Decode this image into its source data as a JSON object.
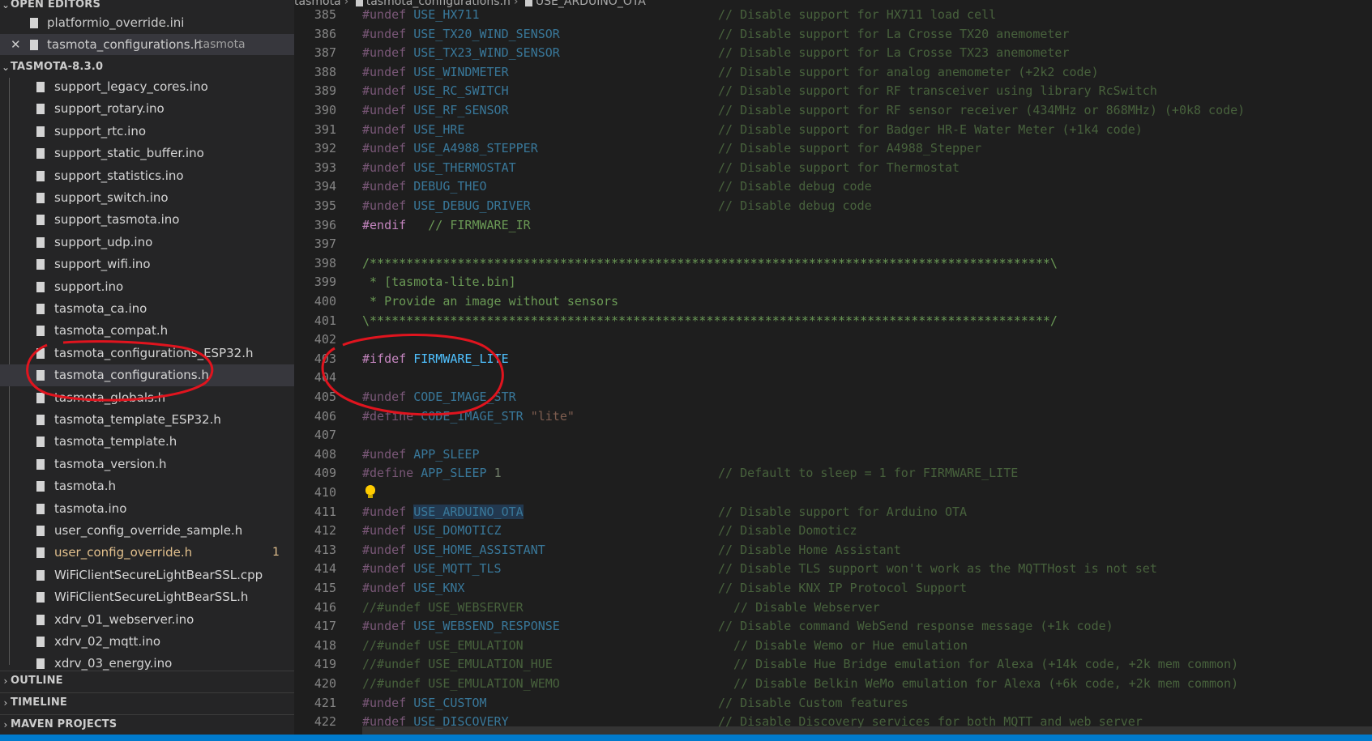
{
  "sidebar": {
    "open_editors_header": "OPEN EDITORS",
    "open_editors": [
      {
        "name": "platformio_override.ini",
        "desc": "",
        "active": false
      },
      {
        "name": "tasmota_configurations.h",
        "desc": "tasmota",
        "active": true
      }
    ],
    "project_header": "TASMOTA-8.3.0",
    "files": [
      {
        "name": "support_legacy_cores.ino"
      },
      {
        "name": "support_rotary.ino"
      },
      {
        "name": "support_rtc.ino"
      },
      {
        "name": "support_static_buffer.ino"
      },
      {
        "name": "support_statistics.ino"
      },
      {
        "name": "support_switch.ino"
      },
      {
        "name": "support_tasmota.ino"
      },
      {
        "name": "support_udp.ino"
      },
      {
        "name": "support_wifi.ino"
      },
      {
        "name": "support.ino"
      },
      {
        "name": "tasmota_ca.ino"
      },
      {
        "name": "tasmota_compat.h"
      },
      {
        "name": "tasmota_configurations_ESP32.h"
      },
      {
        "name": "tasmota_configurations.h",
        "active": true
      },
      {
        "name": "tasmota_globals.h"
      },
      {
        "name": "tasmota_template_ESP32.h"
      },
      {
        "name": "tasmota_template.h"
      },
      {
        "name": "tasmota_version.h"
      },
      {
        "name": "tasmota.h"
      },
      {
        "name": "tasmota.ino"
      },
      {
        "name": "user_config_override_sample.h"
      },
      {
        "name": "user_config_override.h",
        "modified": true,
        "badge": "1"
      },
      {
        "name": "WiFiClientSecureLightBearSSL.cpp"
      },
      {
        "name": "WiFiClientSecureLightBearSSL.h"
      },
      {
        "name": "xdrv_01_webserver.ino"
      },
      {
        "name": "xdrv_02_mqtt.ino"
      },
      {
        "name": "xdrv_03_energy.ino"
      }
    ],
    "outline_header": "OUTLINE",
    "timeline_header": "TIMELINE",
    "maven_header": "MAVEN PROJECTS"
  },
  "breadcrumb": [
    "tasmota",
    "tasmota_configurations.h",
    "USE_ARDUINO_OTA"
  ],
  "colors": {
    "directive": "#c586c0",
    "macro": "#4fc1ff",
    "comment": "#6a9955",
    "string": "#ce9178",
    "number": "#b5cea8",
    "annotation": "#e0141e"
  },
  "code_lines": [
    {
      "n": "385",
      "d": "#undef",
      "m": "USE_HX711",
      "c": "// Disable support for HX711 load cell",
      "inactive": true
    },
    {
      "n": "386",
      "d": "#undef",
      "m": "USE_TX20_WIND_SENSOR",
      "c": "// Disable support for La Crosse TX20 anemometer",
      "inactive": true
    },
    {
      "n": "387",
      "d": "#undef",
      "m": "USE_TX23_WIND_SENSOR",
      "c": "// Disable support for La Crosse TX23 anemometer",
      "inactive": true
    },
    {
      "n": "388",
      "d": "#undef",
      "m": "USE_WINDMETER",
      "c": "// Disable support for analog anemometer (+2k2 code)",
      "inactive": true
    },
    {
      "n": "389",
      "d": "#undef",
      "m": "USE_RC_SWITCH",
      "c": "// Disable support for RF transceiver using library RcSwitch",
      "inactive": true
    },
    {
      "n": "390",
      "d": "#undef",
      "m": "USE_RF_SENSOR",
      "c": "// Disable support for RF sensor receiver (434MHz or 868MHz) (+0k8 code)",
      "inactive": true
    },
    {
      "n": "391",
      "d": "#undef",
      "m": "USE_HRE",
      "c": "// Disable support for Badger HR-E Water Meter (+1k4 code)",
      "inactive": true
    },
    {
      "n": "392",
      "d": "#undef",
      "m": "USE_A4988_STEPPER",
      "c": "// Disable support for A4988_Stepper",
      "inactive": true
    },
    {
      "n": "393",
      "d": "#undef",
      "m": "USE_THERMOSTAT",
      "c": "// Disable support for Thermostat",
      "inactive": true
    },
    {
      "n": "394",
      "d": "#undef",
      "m": "DEBUG_THEO",
      "c": "// Disable debug code",
      "inactive": true
    },
    {
      "n": "395",
      "d": "#undef",
      "m": "USE_DEBUG_DRIVER",
      "c": "// Disable debug code",
      "inactive": true
    },
    {
      "n": "396",
      "d": "#endif",
      "m": "",
      "t": "  // FIRMWARE_IR",
      "tclass": "cmtc"
    },
    {
      "n": "397",
      "d": "",
      "m": ""
    },
    {
      "n": "398",
      "d": "",
      "m": "",
      "t": "/*********************************************************************************************\\",
      "tclass": "cmtc"
    },
    {
      "n": "399",
      "d": "",
      "m": "",
      "t": " * [tasmota-lite.bin]",
      "tclass": "cmtc"
    },
    {
      "n": "400",
      "d": "",
      "m": "",
      "t": " * Provide an image without sensors",
      "tclass": "cmtc"
    },
    {
      "n": "401",
      "d": "",
      "m": "",
      "t": "\\*********************************************************************************************/",
      "tclass": "cmtc"
    },
    {
      "n": "402",
      "d": "",
      "m": ""
    },
    {
      "n": "403",
      "d": "#ifdef",
      "m": "FIRMWARE_LITE"
    },
    {
      "n": "404",
      "d": "",
      "m": ""
    },
    {
      "n": "405",
      "d": "#undef",
      "m": "CODE_IMAGE_STR",
      "inactive": true
    },
    {
      "n": "406",
      "d": "#define",
      "m": "CODE_IMAGE_STR",
      "s": "\"lite\"",
      "inactive": true
    },
    {
      "n": "407",
      "d": "",
      "m": ""
    },
    {
      "n": "408",
      "d": "#undef",
      "m": "APP_SLEEP",
      "inactive": true
    },
    {
      "n": "409",
      "d": "#define",
      "m": "APP_SLEEP",
      "num": "1",
      "c": "// Default to sleep = 1 for FIRMWARE_LITE",
      "inactive": true
    },
    {
      "n": "410",
      "d": "",
      "m": "",
      "bulb": true
    },
    {
      "n": "411",
      "d": "#undef",
      "m": "USE_ARDUINO_OTA",
      "c": "// Disable support for Arduino OTA",
      "inactive": true,
      "hl": true
    },
    {
      "n": "412",
      "d": "#undef",
      "m": "USE_DOMOTICZ",
      "c": "// Disable Domoticz",
      "inactive": true
    },
    {
      "n": "413",
      "d": "#undef",
      "m": "USE_HOME_ASSISTANT",
      "c": "// Disable Home Assistant",
      "inactive": true
    },
    {
      "n": "414",
      "d": "#undef",
      "m": "USE_MQTT_TLS",
      "c": "// Disable TLS support won't work as the MQTTHost is not set",
      "inactive": true
    },
    {
      "n": "415",
      "d": "#undef",
      "m": "USE_KNX",
      "c": "// Disable KNX IP Protocol Support",
      "inactive": true
    },
    {
      "n": "416",
      "d": "//#undef",
      "m": "USE_WEBSERVER",
      "c": "// Disable Webserver",
      "inactive": true,
      "commented": true
    },
    {
      "n": "417",
      "d": "#undef",
      "m": "USE_WEBSEND_RESPONSE",
      "c": "// Disable command WebSend response message (+1k code)",
      "inactive": true
    },
    {
      "n": "418",
      "d": "//#undef",
      "m": "USE_EMULATION",
      "c": "// Disable Wemo or Hue emulation",
      "inactive": true,
      "commented": true
    },
    {
      "n": "419",
      "d": "//#undef",
      "m": "USE_EMULATION_HUE",
      "c": "// Disable Hue Bridge emulation for Alexa (+14k code, +2k mem common)",
      "inactive": true,
      "commented": true
    },
    {
      "n": "420",
      "d": "//#undef",
      "m": "USE_EMULATION_WEMO",
      "c": "// Disable Belkin WeMo emulation for Alexa (+6k code, +2k mem common)",
      "inactive": true,
      "commented": true
    },
    {
      "n": "421",
      "d": "#undef",
      "m": "USE_CUSTOM",
      "c": "// Disable Custom features",
      "inactive": true
    },
    {
      "n": "422",
      "d": "#undef",
      "m": "USE_DISCOVERY",
      "c": "// Disable Discovery services for both MQTT and web server",
      "inactive": true
    }
  ]
}
